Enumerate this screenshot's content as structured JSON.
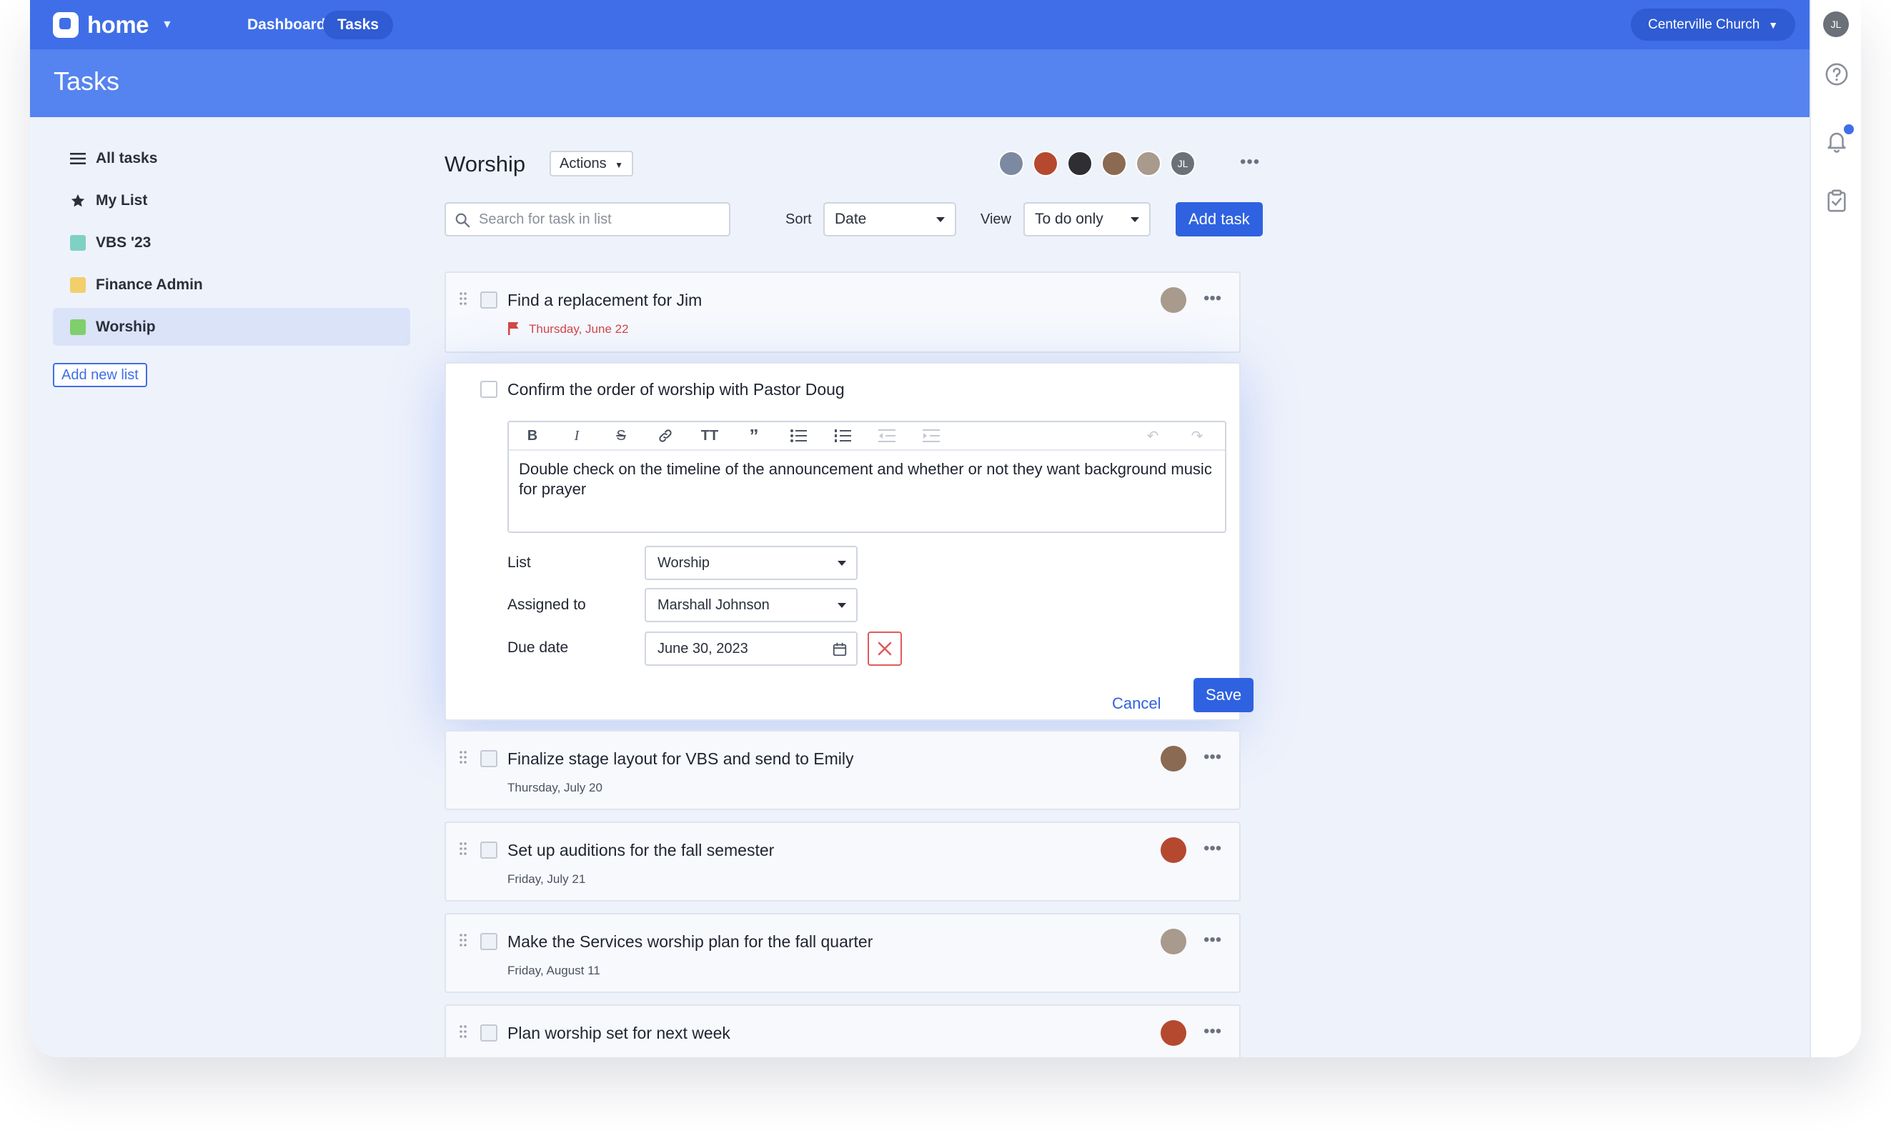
{
  "topbar": {
    "brand": "home",
    "nav": [
      {
        "label": "Dashboard"
      },
      {
        "label": "Tasks"
      }
    ],
    "org": "Centerville Church",
    "user_initials": "JL"
  },
  "page": {
    "title": "Tasks"
  },
  "sidebar": {
    "items": [
      {
        "label": "All tasks"
      },
      {
        "label": "My List"
      },
      {
        "label": "VBS '23",
        "color": "#7fd1c4"
      },
      {
        "label": "Finance Admin",
        "color": "#f2cf6b"
      },
      {
        "label": "Worship",
        "color": "#7fcf6c"
      }
    ],
    "add_list_label": "Add new list"
  },
  "list": {
    "title": "Worship",
    "actions_label": "Actions",
    "member_initials": "JL",
    "search_placeholder": "Search for task in list",
    "sort_label": "Sort",
    "sort_value": "Date",
    "view_label": "View",
    "view_value": "To do only",
    "add_task_label": "Add task"
  },
  "tasks": [
    {
      "title": "Find a replacement for Jim",
      "date": "Thursday, June 22",
      "overdue": true
    },
    {
      "title": "Finalize stage layout for VBS and send to Emily",
      "date": "Thursday, July 20"
    },
    {
      "title": "Set up auditions for the fall semester",
      "date": "Friday, July 21"
    },
    {
      "title": "Make the Services worship plan for the fall quarter",
      "date": "Friday, August 11"
    },
    {
      "title": "Plan worship set for next week",
      "date": ""
    }
  ],
  "editor": {
    "title": "Confirm the order of worship with Pastor Doug",
    "notes": "Double check on the timeline of the announcement and whether or not they want background music for prayer",
    "list_label": "List",
    "list_value": "Worship",
    "assigned_label": "Assigned to",
    "assigned_value": "Marshall Johnson",
    "due_label": "Due date",
    "due_value": "June 30, 2023",
    "cancel_label": "Cancel",
    "save_label": "Save"
  },
  "colors": {
    "primary": "#3f6ee8",
    "header": "#5583ef",
    "danger": "#d64545"
  }
}
